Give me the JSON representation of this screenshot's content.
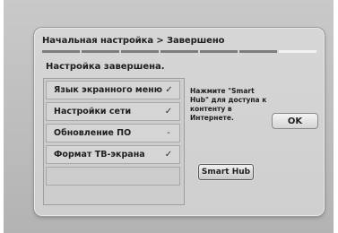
{
  "dialog": {
    "title": "Начальная настройка > Завершено",
    "subtitle": "Настройка завершена.",
    "progress": {
      "total_steps": 7,
      "current_step": 7
    },
    "items": [
      {
        "label": "Язык экранного меню",
        "status": "✓"
      },
      {
        "label": "Настройки сети",
        "status": "✓"
      },
      {
        "label": "Обновление ПО",
        "status": "-"
      },
      {
        "label": "Формат ТВ-экрана",
        "status": "✓"
      },
      {
        "label": "",
        "status": ""
      }
    ],
    "info_text": "Нажмите \"Smart Hub\" для доступа к контенту в Интернете.",
    "ok_label": "OK",
    "smart_hub_label": "Smart Hub"
  },
  "colors": {
    "background": "#c4c4c4",
    "dialog": "#d3d3d3",
    "progress_done": "#7d7d7d",
    "progress_active": "#f2f2f2"
  }
}
